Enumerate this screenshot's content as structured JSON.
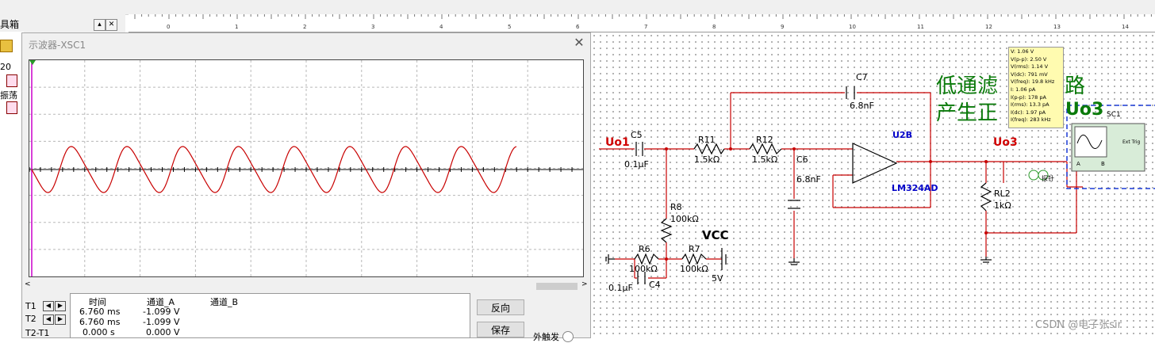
{
  "toolbox": {
    "title": "具箱",
    "tree_items": [
      "20",
      "振荡"
    ]
  },
  "ruler": {
    "ticks": [
      "0",
      "1",
      "2",
      "3",
      "4",
      "5",
      "6",
      "7",
      "8",
      "9",
      "10",
      "11",
      "12",
      "13",
      "14"
    ]
  },
  "scope": {
    "window_title": "示波器-XSC1",
    "close_glyph": "✕",
    "readout": {
      "headers": [
        "时间",
        "通道_A",
        "通道_B"
      ],
      "rows": [
        {
          "label": "T1",
          "time": "6.760 ms",
          "cha": "-1.099 V",
          "chb": ""
        },
        {
          "label": "T2",
          "time": "6.760 ms",
          "cha": "-1.099 V",
          "chb": ""
        },
        {
          "label": "T2-T1",
          "time": "0.000 s",
          "cha": "0.000 V",
          "chb": ""
        }
      ]
    },
    "buttons": {
      "reverse": "反向",
      "save": "保存"
    },
    "ext_trigger_label": "外触发",
    "trace_color": "#c80000"
  },
  "circuit": {
    "uo1": "Uo1",
    "uo3": "Uo3",
    "uo3_big": "Uo3",
    "c5": "C5",
    "c5_val": "0.1µF",
    "r11": "R11",
    "r11_val": "1.5kΩ",
    "r12": "R12",
    "r12_val": "1.5kΩ",
    "c6": "C6",
    "c6_val": "6.8nF",
    "c7": "C7",
    "c7_val": "6.8nF",
    "u2b": "U2B",
    "lm324": "LM324AD",
    "r8": "R8",
    "r8_val": "100kΩ",
    "r6": "R6",
    "r6_val": "100kΩ",
    "c4": "C4",
    "c4_val": "0.1µF",
    "r7": "R7",
    "r7_val": "100kΩ",
    "vcc": "VCC",
    "vcc_val": "5V",
    "rl2": "RL2",
    "rl2_val": "1kΩ",
    "title_line1": "低通滤",
    "title_line1b": "路",
    "title_line2": "产生正",
    "probe_label": "探针",
    "xsc_label": "SC1",
    "scope_a": "A",
    "scope_b": "B",
    "ext_trig": "Ext Trig"
  },
  "probe_tooltip": {
    "lines": [
      "V: 1.06 V",
      "V(p-p): 2.50 V",
      "V(rms): 1.14 V",
      "V(dc): 791 mV",
      "V(freq): 19.8 kHz",
      "I: 1.06 pA",
      "I(p-p): 178 pA",
      "I(rms): 13.3 pA",
      "I(dc): 1.97 pA",
      "I(freq): 283 kHz"
    ]
  },
  "watermark": "CSDN @电子张sir"
}
